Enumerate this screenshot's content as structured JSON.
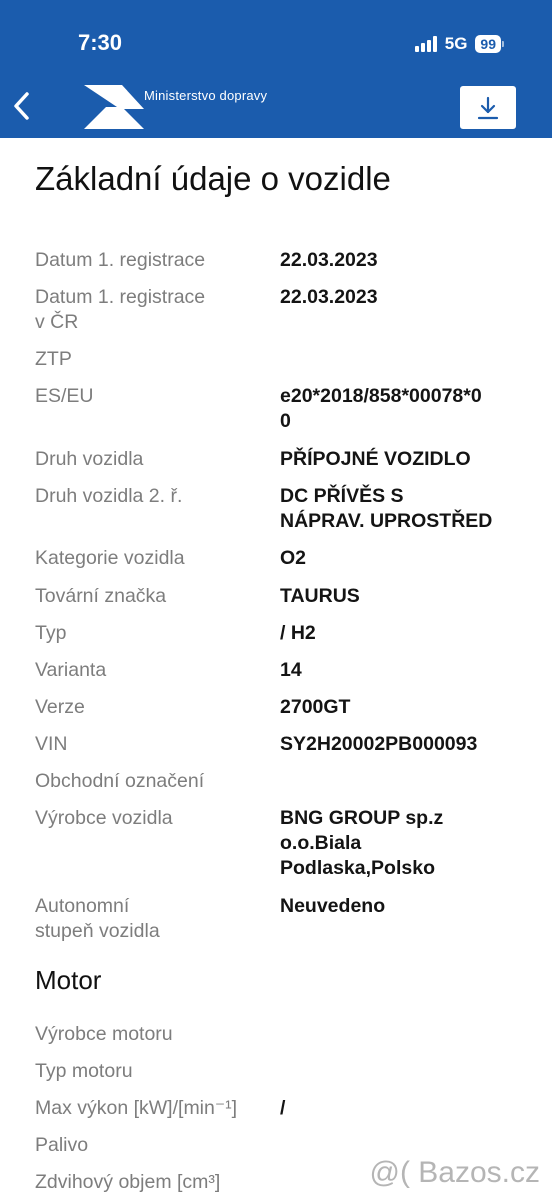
{
  "status_bar": {
    "time": "7:30",
    "network": "5G",
    "battery": "99"
  },
  "header": {
    "brand": "Ministerstvo dopravy"
  },
  "page_title": "Základní údaje o vozidle",
  "basic_rows": [
    {
      "label": "Datum 1. registrace",
      "value": "22.03.2023"
    },
    {
      "label": "Datum 1. registrace\nv ČR",
      "value": "22.03.2023"
    },
    {
      "label": "ZTP",
      "value": ""
    },
    {
      "label": "ES/EU",
      "value": "e20*2018/858*00078*0\n0"
    },
    {
      "label": "Druh vozidla",
      "value": "PŘÍPOJNÉ VOZIDLO"
    },
    {
      "label": "Druh vozidla 2. ř.",
      "value": "DC PŘÍVĚS S\nNÁPRAV. UPROSTŘED"
    },
    {
      "label": "Kategorie vozidla",
      "value": "O2"
    },
    {
      "label": "Tovární značka",
      "value": "TAURUS"
    },
    {
      "label": "Typ",
      "value": " / H2"
    },
    {
      "label": "Varianta",
      "value": "14"
    },
    {
      "label": "Verze",
      "value": "2700GT"
    },
    {
      "label": "VIN",
      "value": "SY2H20002PB000093"
    },
    {
      "label": "Obchodní označení",
      "value": ""
    },
    {
      "label": "Výrobce vozidla",
      "value": "BNG GROUP sp.z\no.o.Biala\nPodlaska,Polsko"
    },
    {
      "label": "Autonomní\nstupeň vozidla",
      "value": "Neuvedeno"
    }
  ],
  "motor_title": "Motor",
  "motor_rows": [
    {
      "label": "Výrobce motoru",
      "value": ""
    },
    {
      "label": "Typ motoru",
      "value": ""
    },
    {
      "label": "Max výkon [kW]/[min⁻¹]",
      "value": "/"
    },
    {
      "label": "Palivo",
      "value": ""
    },
    {
      "label": "Zdvihový objem [cm³]",
      "value": ""
    }
  ],
  "watermark": "@( Bazos.cz"
}
